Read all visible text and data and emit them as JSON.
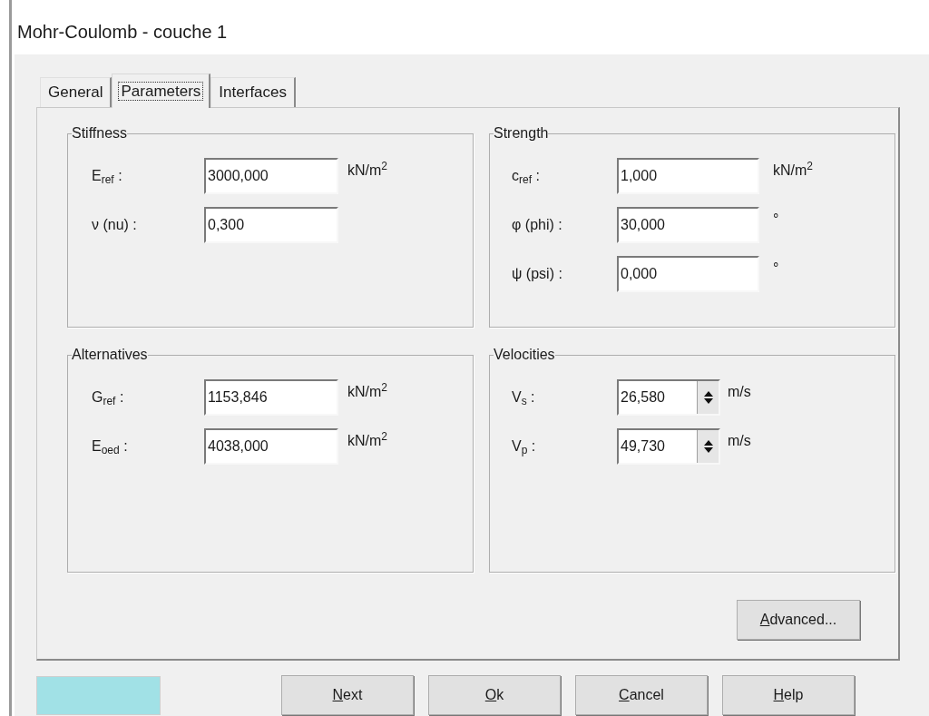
{
  "window": {
    "title": "Mohr-Coulomb - couche 1"
  },
  "tabs": [
    {
      "label": "General",
      "selected": false
    },
    {
      "label": "Parameters",
      "selected": true
    },
    {
      "label": "Interfaces",
      "selected": false
    }
  ],
  "groups": [
    {
      "title": "Stiffness",
      "fields": [
        {
          "kind": "text",
          "label": "E$_{ref}$ :",
          "value": "3000,000",
          "unit": "kN/m$^{2}$"
        },
        {
          "kind": "text",
          "label": "ν (nu) :",
          "value": "0,300"
        }
      ]
    },
    {
      "title": "Strength",
      "fields": [
        {
          "kind": "text",
          "label": "c$_{ref}$ :",
          "value": "1,000",
          "unit": "kN/m$^{2}$"
        },
        {
          "kind": "text",
          "label": "φ (phi) :",
          "value": "30,000",
          "unit": "°"
        },
        {
          "kind": "text",
          "label": "ψ (psi) :",
          "value": "0,000",
          "unit": "°"
        }
      ]
    },
    {
      "title": "Alternatives",
      "fields": [
        {
          "kind": "text",
          "label": "G$_{ref}$ :",
          "value": "1153,846",
          "unit": "kN/m$^{2}$"
        },
        {
          "kind": "text",
          "label": "E$_{oed}$ :",
          "value": "4038,000",
          "unit": "kN/m$^{2}$"
        }
      ]
    },
    {
      "title": "Velocities",
      "fields": [
        {
          "kind": "spin",
          "label": "V$_{s}$ :",
          "value": "26,580",
          "unit": "m/s"
        },
        {
          "kind": "spin",
          "label": "V$_{p}$ :",
          "value": "49,730",
          "unit": "m/s"
        }
      ]
    }
  ],
  "advanced_button": {
    "label": "Advanced...",
    "mnemonic_underlined": true
  },
  "buttons": [
    {
      "label": "Next",
      "mnemonic_underlined": true
    },
    {
      "label": "Ok",
      "mnemonic_underlined": true
    },
    {
      "label": "Cancel",
      "mnemonic_underlined": true
    },
    {
      "label": "Help",
      "mnemonic_underlined": true
    }
  ]
}
